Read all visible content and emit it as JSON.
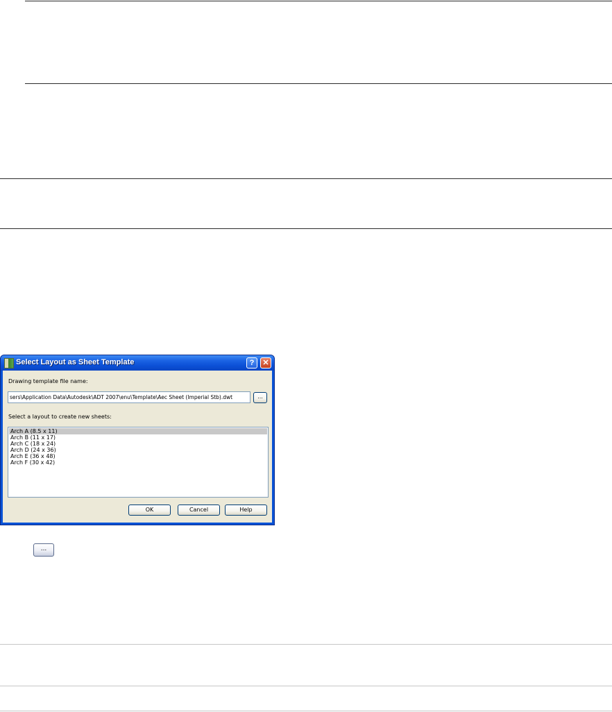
{
  "dialog": {
    "title": "Select Layout as Sheet Template",
    "help_button_label": "?",
    "close_button_label": "✕",
    "template_label": "Drawing template file name:",
    "template_path": "sers\\Application Data\\Autodesk\\ADT 2007\\enu\\Template\\Aec Sheet (Imperial Stb).dwt",
    "browse_label": "...",
    "layout_label": "Select a layout to create new sheets:",
    "layouts": [
      "Arch A (8.5 x 11)",
      "Arch B (11 x 17)",
      "Arch C (18 x 24)",
      "Arch D (24 x 36)",
      "Arch E (36 x 48)",
      "Arch F (30 x 42)"
    ],
    "selected_layout": "Arch A (8.5 x 11)",
    "ok_label": "OK",
    "cancel_label": "Cancel",
    "help_label": "Help"
  },
  "standalone_button": {
    "label": "..."
  },
  "colors": {
    "titlebar": "#0a53d6",
    "dialog_face": "#ece9d8",
    "selection": "#c8c8c8"
  }
}
